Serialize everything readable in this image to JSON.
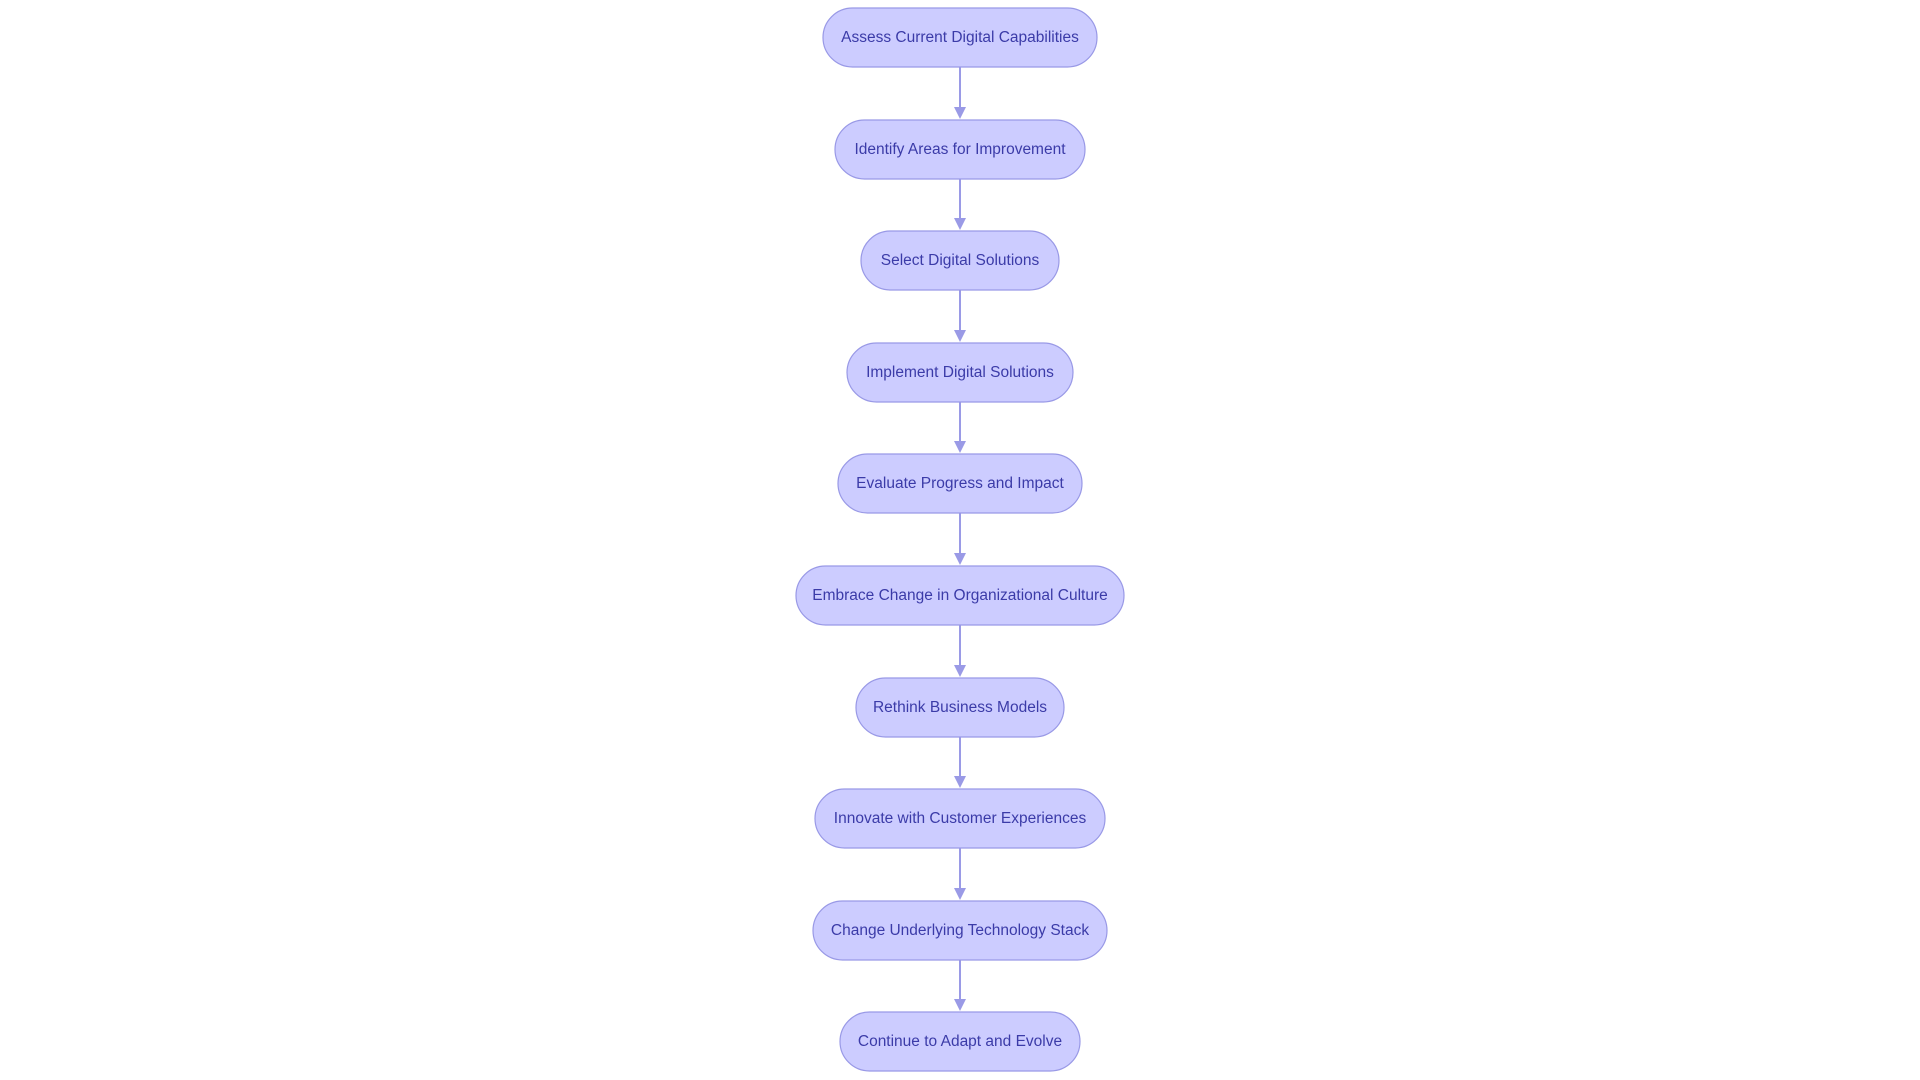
{
  "diagram": {
    "type": "flowchart",
    "direction": "top-to-bottom",
    "colors": {
      "node_fill": "#ccccff",
      "node_stroke": "#9999e6",
      "edge": "#9a9ae6",
      "text": "#3b3ba8",
      "background": "#ffffff"
    },
    "nodes": [
      {
        "id": "A",
        "label": "Assess Current Digital Capabilities"
      },
      {
        "id": "B",
        "label": "Identify Areas for Improvement"
      },
      {
        "id": "C",
        "label": "Select Digital Solutions"
      },
      {
        "id": "D",
        "label": "Implement Digital Solutions"
      },
      {
        "id": "E",
        "label": "Evaluate Progress and Impact"
      },
      {
        "id": "F",
        "label": "Embrace Change in Organizational Culture"
      },
      {
        "id": "G",
        "label": "Rethink Business Models"
      },
      {
        "id": "H",
        "label": "Innovate with Customer Experiences"
      },
      {
        "id": "I",
        "label": "Change Underlying Technology Stack"
      },
      {
        "id": "J",
        "label": "Continue to Adapt and Evolve"
      }
    ],
    "edges": [
      {
        "from": "A",
        "to": "B"
      },
      {
        "from": "B",
        "to": "C"
      },
      {
        "from": "C",
        "to": "D"
      },
      {
        "from": "D",
        "to": "E"
      },
      {
        "from": "E",
        "to": "F"
      },
      {
        "from": "F",
        "to": "G"
      },
      {
        "from": "G",
        "to": "H"
      },
      {
        "from": "H",
        "to": "I"
      },
      {
        "from": "I",
        "to": "J"
      }
    ]
  }
}
